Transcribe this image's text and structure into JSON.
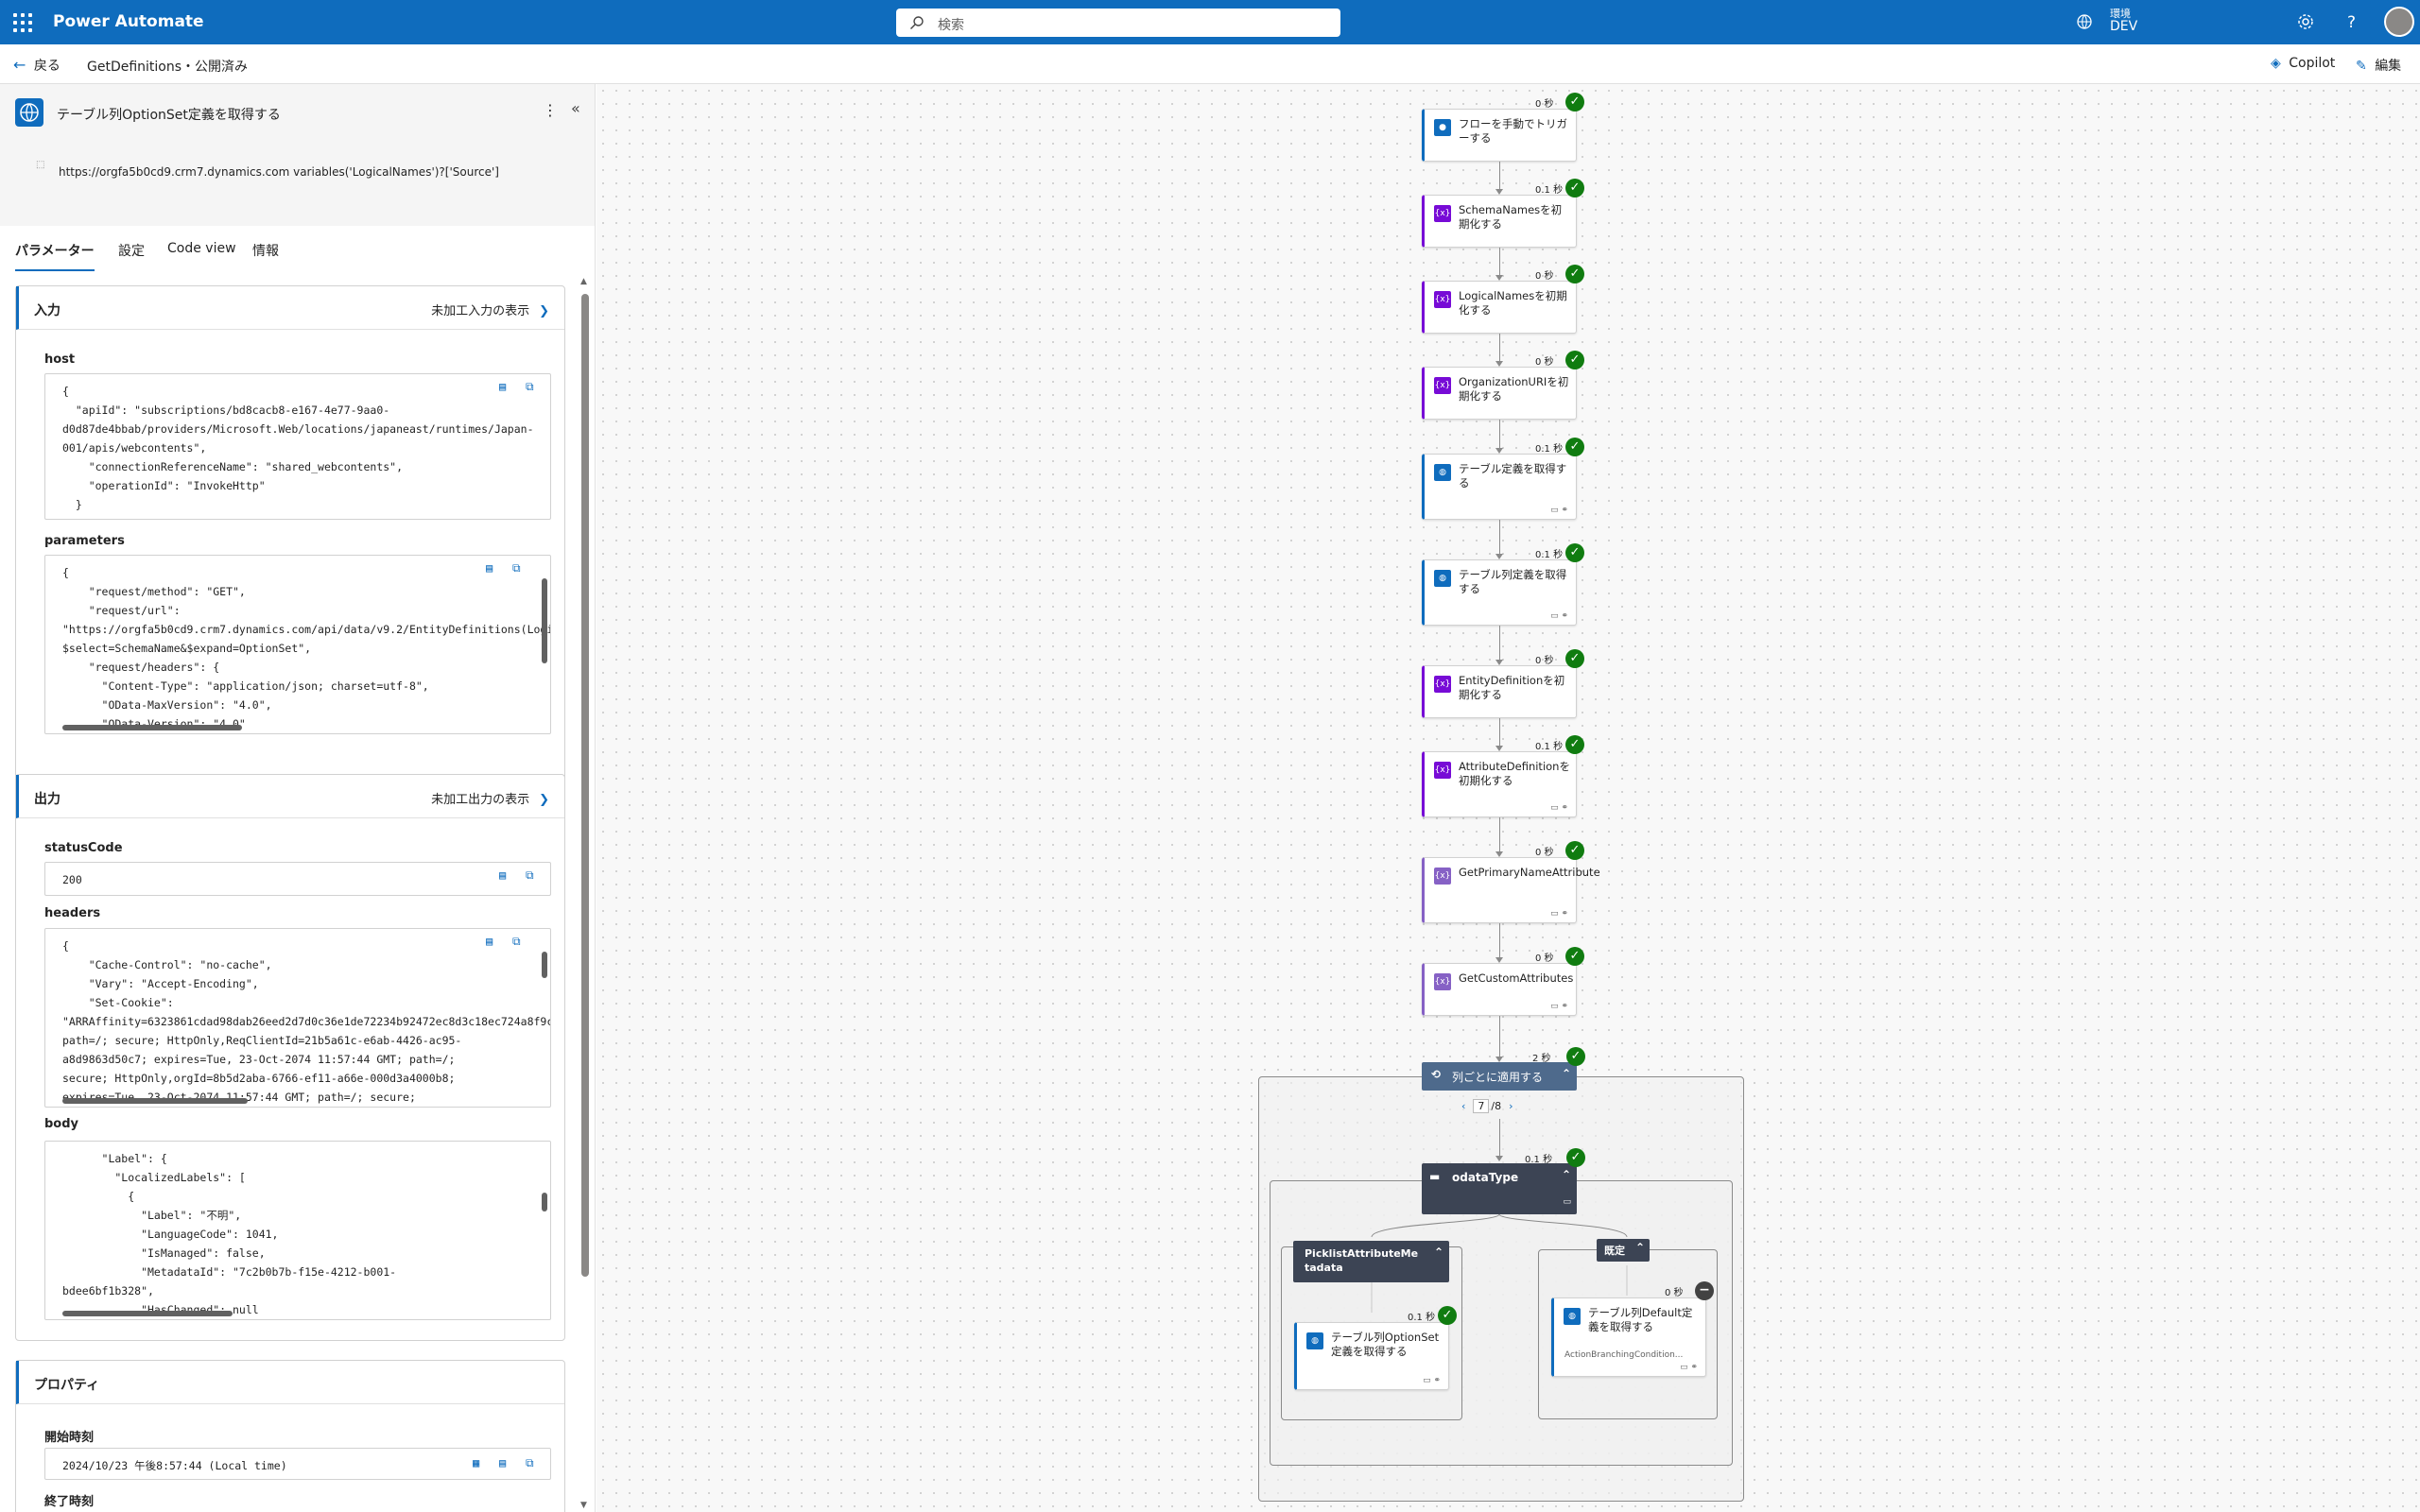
{
  "app": {
    "name": "Power Automate"
  },
  "search": {
    "placeholder": "検索"
  },
  "environment": {
    "label": "環境",
    "name": "DEV"
  },
  "nav": {
    "back_label": "戻る",
    "breadcrumb": "GetDefinitions・公開済み",
    "copilot_label": "Copilot",
    "edit_label": "編集"
  },
  "panel": {
    "title": "テーブル列OptionSet定義を取得する",
    "url": "https://orgfa5b0cd9.crm7.dynamics.com variables('LogicalNames')?['Source']",
    "tabs": [
      "パラメーター",
      "設定",
      "Code view",
      "情報"
    ],
    "input_card": {
      "title": "入力",
      "link": "未加工入力の表示",
      "host_label": "host",
      "host_value": "{\n  \"apiId\": \"subscriptions/bd8cacb8-e167-4e77-9aa0-\nd0d87de4bbab/providers/Microsoft.Web/locations/japaneast/runtimes/Japan-\n001/apis/webcontents\",\n    \"connectionReferenceName\": \"shared_webcontents\",\n    \"operationId\": \"InvokeHttp\"\n  }",
      "parameters_label": "parameters",
      "parameters_value": "{\n    \"request/method\": \"GET\",\n    \"request/url\":\n\"https://orgfa5b0cd9.crm7.dynamics.com/api/data/v9.2/EntityDefinitions(Logi\n$select=SchemaName&$expand=OptionSet\",\n    \"request/headers\": {\n      \"Content-Type\": \"application/json; charset=utf-8\",\n      \"OData-MaxVersion\": \"4.0\",\n      \"OData-Version\": \"4.0\""
    },
    "output_card": {
      "title": "出力",
      "link": "未加工出力の表示",
      "status_label": "statusCode",
      "status_value": "200",
      "headers_label": "headers",
      "headers_value": "{\n    \"Cache-Control\": \"no-cache\",\n    \"Vary\": \"Accept-Encoding\",\n    \"Set-Cookie\":\n\"ARRAffinity=6323861cdad98dab26eed2d7d0c36e1de72234b92472ec8d3c18ec724a8f9c\npath=/; secure; HttpOnly,ReqClientId=21b5a61c-e6ab-4426-ac95-\na8d9863d50c7; expires=Tue, 23-Oct-2074 11:57:44 GMT; path=/;\nsecure; HttpOnly,orgId=8b5d2aba-6766-ef11-a66e-000d3a4000b8;\nexpires=Tue, 23-Oct-2074 11:57:44 GMT; path=/; secure;",
      "body_label": "body",
      "body_value": "      \"Label\": {\n        \"LocalizedLabels\": [\n          {\n            \"Label\": \"不明\",\n            \"LanguageCode\": 1041,\n            \"IsManaged\": false,\n            \"MetadataId\": \"7c2b0b7b-f15e-4212-b001-\nbdee6bf1b328\",\n            \"HasChanged\": null"
    },
    "props_card": {
      "title": "プロパティ",
      "start_label": "開始時刻",
      "start_value": "2024/10/23 午後8:57:44 (Local time)",
      "end_label": "終了時刻"
    }
  },
  "flow": {
    "nodes": [
      {
        "label": "フローを手動でトリガーする",
        "duration": "0 秒",
        "kind": "trigger"
      },
      {
        "label": "SchemaNamesを初期化する",
        "duration": "0.1 秒",
        "kind": "var"
      },
      {
        "label": "LogicalNamesを初期化する",
        "duration": "0 秒",
        "kind": "var"
      },
      {
        "label": "OrganizationURIを初期化する",
        "duration": "0 秒",
        "kind": "var"
      },
      {
        "label": "テーブル定義を取得する",
        "duration": "0.1 秒",
        "kind": "http"
      },
      {
        "label": "テーブル列定義を取得する",
        "duration": "0.1 秒",
        "kind": "http"
      },
      {
        "label": "EntityDefinitionを初期化する",
        "duration": "0 秒",
        "kind": "var"
      },
      {
        "label": "AttributeDefinitionを初期化する",
        "duration": "0.1 秒",
        "kind": "var"
      },
      {
        "label": "GetPrimaryNameAttribute",
        "duration": "0 秒",
        "kind": "comp"
      },
      {
        "label": "GetCustomAttributes",
        "duration": "0 秒",
        "kind": "comp"
      }
    ],
    "foreach": {
      "label": "列ごとに適用する",
      "duration": "2 秒",
      "page": "7",
      "total": "/8"
    },
    "switch": {
      "label": "odataType",
      "duration": "0.1 秒"
    },
    "case1": {
      "label": "PicklistAttributeMetadata",
      "action": "テーブル列OptionSet定義を取得する",
      "duration": "0.1 秒"
    },
    "default": {
      "label": "既定",
      "action": "テーブル列Default定義を取得する",
      "note": "ActionBranchingCondition...",
      "duration": "0 秒"
    }
  },
  "colors": {
    "brand": "#0f6cbd",
    "success": "#107c10",
    "variable": "#770bd6"
  }
}
